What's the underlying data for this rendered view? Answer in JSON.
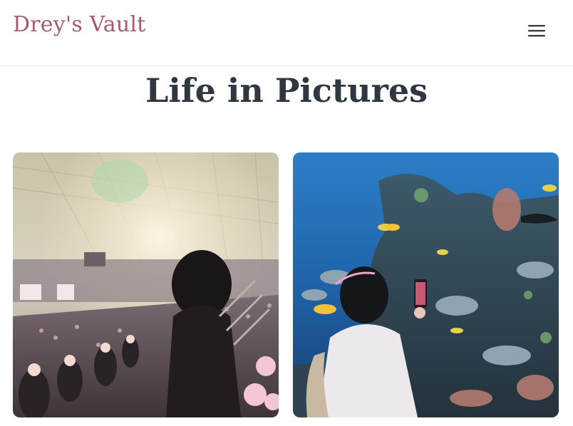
{
  "header": {
    "site_title": "Drey's Vault",
    "menu_icon": "hamburger-menu-icon"
  },
  "main": {
    "page_title": "Life in Pictures"
  },
  "gallery": {
    "photos": [
      {
        "icon": "concert-stadium-photo"
      },
      {
        "icon": "aquarium-photo"
      }
    ]
  },
  "colors": {
    "title": "#a55a6e",
    "heading": "#2f3740",
    "icon": "#3a3f45"
  }
}
